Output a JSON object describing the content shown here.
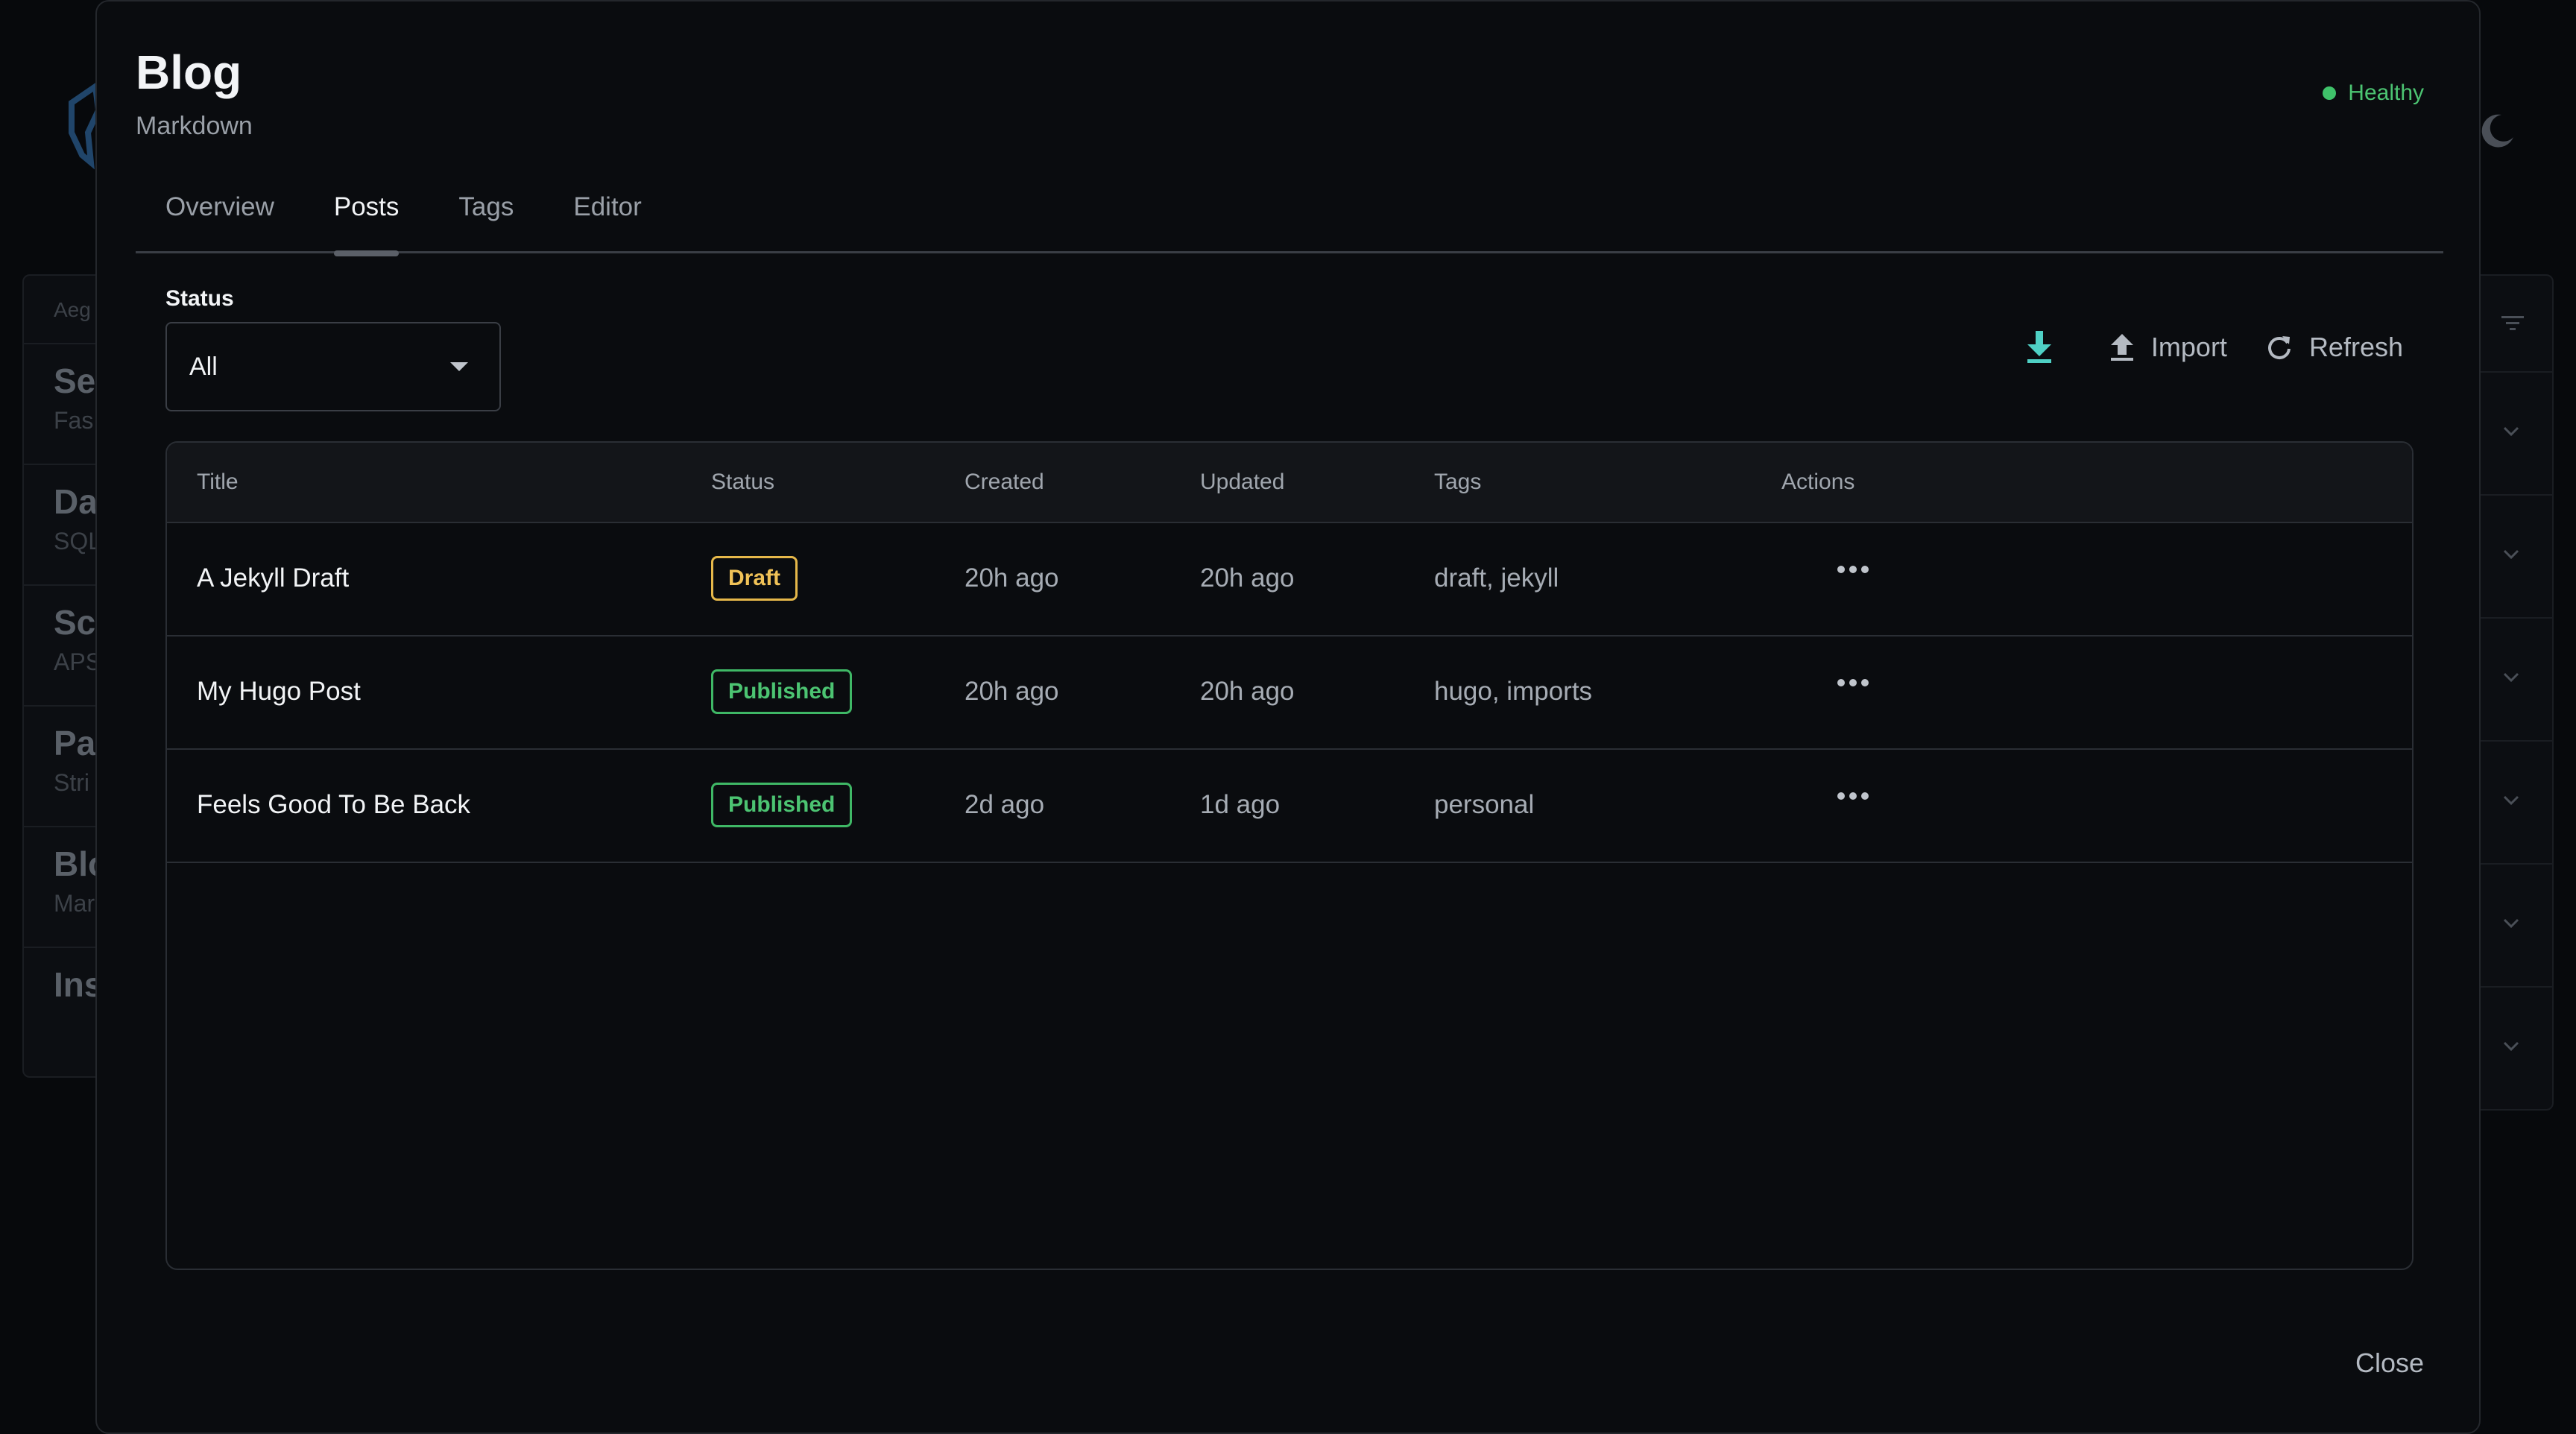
{
  "background": {
    "sidebar_header": "Aeg",
    "items": [
      {
        "title": "Se",
        "subtitle": "Fas"
      },
      {
        "title": "Da",
        "subtitle": "SQL"
      },
      {
        "title": "Sc",
        "subtitle": "APS"
      },
      {
        "title": "Pa",
        "subtitle": "Stri"
      },
      {
        "title": "Blo",
        "subtitle": "Mar"
      },
      {
        "title": "Ins",
        "subtitle": ""
      }
    ],
    "icons": [
      "shield-logo-icon",
      "moon-icon",
      "filter-icon",
      "chevron-down-icon"
    ]
  },
  "modal": {
    "title": "Blog",
    "subtitle": "Markdown",
    "health": "Healthy",
    "tabs": [
      "Overview",
      "Posts",
      "Tags",
      "Editor"
    ],
    "active_tab": "Posts",
    "filter": {
      "label": "Status",
      "value": "All"
    },
    "toolbar": {
      "import_label": "Import",
      "refresh_label": "Refresh"
    },
    "table": {
      "columns": [
        "Title",
        "Status",
        "Created",
        "Updated",
        "Tags",
        "Actions"
      ],
      "rows": [
        {
          "title": "A Jekyll Draft",
          "status": "Draft",
          "created": "20h ago",
          "updated": "20h ago",
          "tags": "draft, jekyll"
        },
        {
          "title": "My Hugo Post",
          "status": "Published",
          "created": "20h ago",
          "updated": "20h ago",
          "tags": "hugo, imports"
        },
        {
          "title": "Feels Good To Be Back",
          "status": "Published",
          "created": "2d ago",
          "updated": "1d ago",
          "tags": "personal"
        }
      ]
    },
    "close_label": "Close"
  },
  "colors": {
    "accent_teal": "#4fd1c5",
    "healthy_green": "#4cc472",
    "draft_yellow": "#f0c257",
    "published_green": "#4cc472"
  }
}
